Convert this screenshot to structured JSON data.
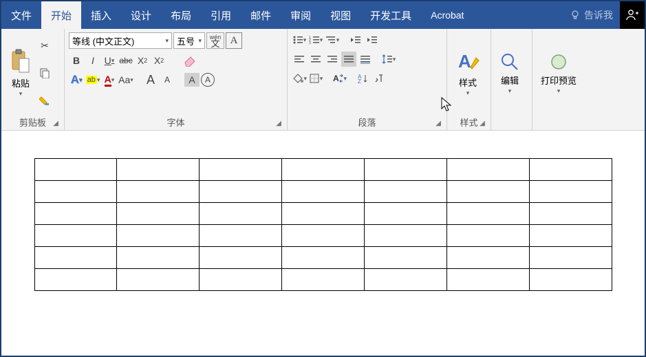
{
  "tabs": {
    "file": "文件",
    "home": "开始",
    "insert": "插入",
    "design": "设计",
    "layout": "布局",
    "references": "引用",
    "mailings": "邮件",
    "review": "审阅",
    "view": "视图",
    "developer": "开发工具",
    "acrobat": "Acrobat"
  },
  "tellme": "告诉我",
  "groups": {
    "clipboard": "剪贴板",
    "font": "字体",
    "paragraph": "段落",
    "styles": "样式"
  },
  "clipboard": {
    "paste": "粘贴"
  },
  "font": {
    "name": "等线 (中文正文)",
    "size": "五号",
    "pinyin": "wén",
    "bold": "B",
    "italic": "I",
    "underline": "U",
    "strike": "abc",
    "sub": "X",
    "sup": "X",
    "charA": "A",
    "aa": "Aa"
  },
  "bigbuttons": {
    "styles": "样式",
    "edit": "编辑",
    "preview": "打印预览"
  },
  "table": {
    "rows": 6,
    "cols": 7
  }
}
